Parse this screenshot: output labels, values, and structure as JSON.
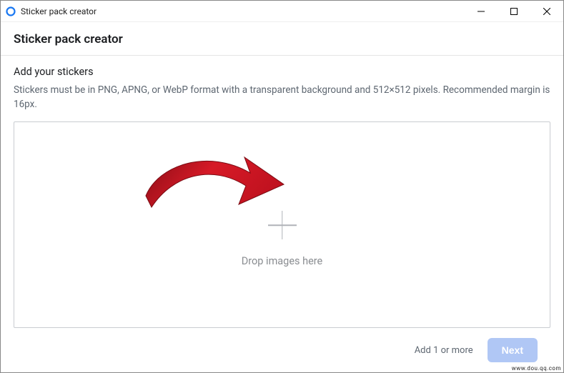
{
  "window": {
    "title": "Sticker pack creator"
  },
  "header": {
    "title": "Sticker pack creator"
  },
  "main": {
    "section_title": "Add your stickers",
    "section_desc": "Stickers must be in PNG, APNG, or WebP format with a transparent background and 512×512 pixels. Recommended margin is 16px.",
    "dropzone_text": "Drop images here"
  },
  "footer": {
    "status": "Add 1 or more",
    "next_label": "Next"
  },
  "watermark": "www.dou.qq.com",
  "colors": {
    "button_primary_disabled": "#b0c7f5",
    "text_muted": "#8a8d91",
    "annotation_arrow": "#c1121f"
  }
}
